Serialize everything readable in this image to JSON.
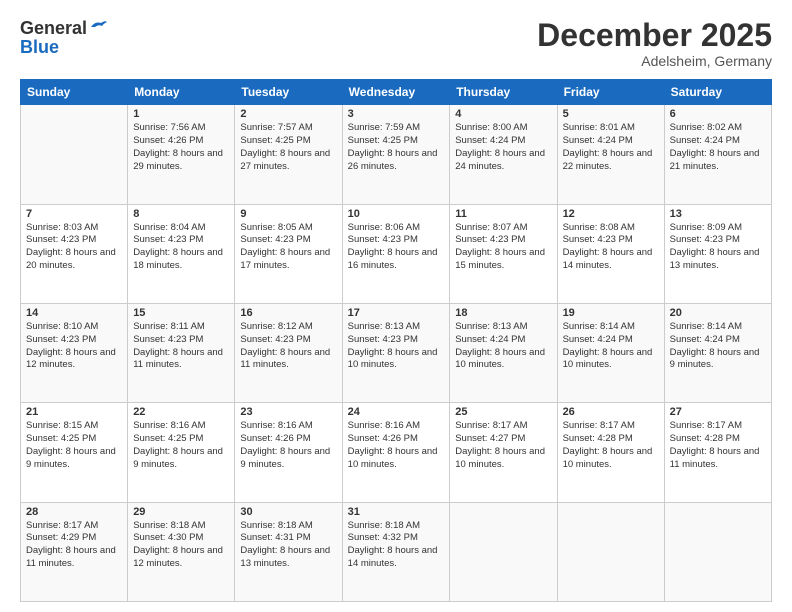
{
  "header": {
    "logo_general": "General",
    "logo_blue": "Blue",
    "month_title": "December 2025",
    "location": "Adelsheim, Germany"
  },
  "days_of_week": [
    "Sunday",
    "Monday",
    "Tuesday",
    "Wednesday",
    "Thursday",
    "Friday",
    "Saturday"
  ],
  "weeks": [
    [
      {
        "day": "",
        "sunrise": "",
        "sunset": "",
        "daylight": ""
      },
      {
        "day": "1",
        "sunrise": "Sunrise: 7:56 AM",
        "sunset": "Sunset: 4:26 PM",
        "daylight": "Daylight: 8 hours and 29 minutes."
      },
      {
        "day": "2",
        "sunrise": "Sunrise: 7:57 AM",
        "sunset": "Sunset: 4:25 PM",
        "daylight": "Daylight: 8 hours and 27 minutes."
      },
      {
        "day": "3",
        "sunrise": "Sunrise: 7:59 AM",
        "sunset": "Sunset: 4:25 PM",
        "daylight": "Daylight: 8 hours and 26 minutes."
      },
      {
        "day": "4",
        "sunrise": "Sunrise: 8:00 AM",
        "sunset": "Sunset: 4:24 PM",
        "daylight": "Daylight: 8 hours and 24 minutes."
      },
      {
        "day": "5",
        "sunrise": "Sunrise: 8:01 AM",
        "sunset": "Sunset: 4:24 PM",
        "daylight": "Daylight: 8 hours and 22 minutes."
      },
      {
        "day": "6",
        "sunrise": "Sunrise: 8:02 AM",
        "sunset": "Sunset: 4:24 PM",
        "daylight": "Daylight: 8 hours and 21 minutes."
      }
    ],
    [
      {
        "day": "7",
        "sunrise": "Sunrise: 8:03 AM",
        "sunset": "Sunset: 4:23 PM",
        "daylight": "Daylight: 8 hours and 20 minutes."
      },
      {
        "day": "8",
        "sunrise": "Sunrise: 8:04 AM",
        "sunset": "Sunset: 4:23 PM",
        "daylight": "Daylight: 8 hours and 18 minutes."
      },
      {
        "day": "9",
        "sunrise": "Sunrise: 8:05 AM",
        "sunset": "Sunset: 4:23 PM",
        "daylight": "Daylight: 8 hours and 17 minutes."
      },
      {
        "day": "10",
        "sunrise": "Sunrise: 8:06 AM",
        "sunset": "Sunset: 4:23 PM",
        "daylight": "Daylight: 8 hours and 16 minutes."
      },
      {
        "day": "11",
        "sunrise": "Sunrise: 8:07 AM",
        "sunset": "Sunset: 4:23 PM",
        "daylight": "Daylight: 8 hours and 15 minutes."
      },
      {
        "day": "12",
        "sunrise": "Sunrise: 8:08 AM",
        "sunset": "Sunset: 4:23 PM",
        "daylight": "Daylight: 8 hours and 14 minutes."
      },
      {
        "day": "13",
        "sunrise": "Sunrise: 8:09 AM",
        "sunset": "Sunset: 4:23 PM",
        "daylight": "Daylight: 8 hours and 13 minutes."
      }
    ],
    [
      {
        "day": "14",
        "sunrise": "Sunrise: 8:10 AM",
        "sunset": "Sunset: 4:23 PM",
        "daylight": "Daylight: 8 hours and 12 minutes."
      },
      {
        "day": "15",
        "sunrise": "Sunrise: 8:11 AM",
        "sunset": "Sunset: 4:23 PM",
        "daylight": "Daylight: 8 hours and 11 minutes."
      },
      {
        "day": "16",
        "sunrise": "Sunrise: 8:12 AM",
        "sunset": "Sunset: 4:23 PM",
        "daylight": "Daylight: 8 hours and 11 minutes."
      },
      {
        "day": "17",
        "sunrise": "Sunrise: 8:13 AM",
        "sunset": "Sunset: 4:23 PM",
        "daylight": "Daylight: 8 hours and 10 minutes."
      },
      {
        "day": "18",
        "sunrise": "Sunrise: 8:13 AM",
        "sunset": "Sunset: 4:24 PM",
        "daylight": "Daylight: 8 hours and 10 minutes."
      },
      {
        "day": "19",
        "sunrise": "Sunrise: 8:14 AM",
        "sunset": "Sunset: 4:24 PM",
        "daylight": "Daylight: 8 hours and 10 minutes."
      },
      {
        "day": "20",
        "sunrise": "Sunrise: 8:14 AM",
        "sunset": "Sunset: 4:24 PM",
        "daylight": "Daylight: 8 hours and 9 minutes."
      }
    ],
    [
      {
        "day": "21",
        "sunrise": "Sunrise: 8:15 AM",
        "sunset": "Sunset: 4:25 PM",
        "daylight": "Daylight: 8 hours and 9 minutes."
      },
      {
        "day": "22",
        "sunrise": "Sunrise: 8:16 AM",
        "sunset": "Sunset: 4:25 PM",
        "daylight": "Daylight: 8 hours and 9 minutes."
      },
      {
        "day": "23",
        "sunrise": "Sunrise: 8:16 AM",
        "sunset": "Sunset: 4:26 PM",
        "daylight": "Daylight: 8 hours and 9 minutes."
      },
      {
        "day": "24",
        "sunrise": "Sunrise: 8:16 AM",
        "sunset": "Sunset: 4:26 PM",
        "daylight": "Daylight: 8 hours and 10 minutes."
      },
      {
        "day": "25",
        "sunrise": "Sunrise: 8:17 AM",
        "sunset": "Sunset: 4:27 PM",
        "daylight": "Daylight: 8 hours and 10 minutes."
      },
      {
        "day": "26",
        "sunrise": "Sunrise: 8:17 AM",
        "sunset": "Sunset: 4:28 PM",
        "daylight": "Daylight: 8 hours and 10 minutes."
      },
      {
        "day": "27",
        "sunrise": "Sunrise: 8:17 AM",
        "sunset": "Sunset: 4:28 PM",
        "daylight": "Daylight: 8 hours and 11 minutes."
      }
    ],
    [
      {
        "day": "28",
        "sunrise": "Sunrise: 8:17 AM",
        "sunset": "Sunset: 4:29 PM",
        "daylight": "Daylight: 8 hours and 11 minutes."
      },
      {
        "day": "29",
        "sunrise": "Sunrise: 8:18 AM",
        "sunset": "Sunset: 4:30 PM",
        "daylight": "Daylight: 8 hours and 12 minutes."
      },
      {
        "day": "30",
        "sunrise": "Sunrise: 8:18 AM",
        "sunset": "Sunset: 4:31 PM",
        "daylight": "Daylight: 8 hours and 13 minutes."
      },
      {
        "day": "31",
        "sunrise": "Sunrise: 8:18 AM",
        "sunset": "Sunset: 4:32 PM",
        "daylight": "Daylight: 8 hours and 14 minutes."
      },
      {
        "day": "",
        "sunrise": "",
        "sunset": "",
        "daylight": ""
      },
      {
        "day": "",
        "sunrise": "",
        "sunset": "",
        "daylight": ""
      },
      {
        "day": "",
        "sunrise": "",
        "sunset": "",
        "daylight": ""
      }
    ]
  ]
}
